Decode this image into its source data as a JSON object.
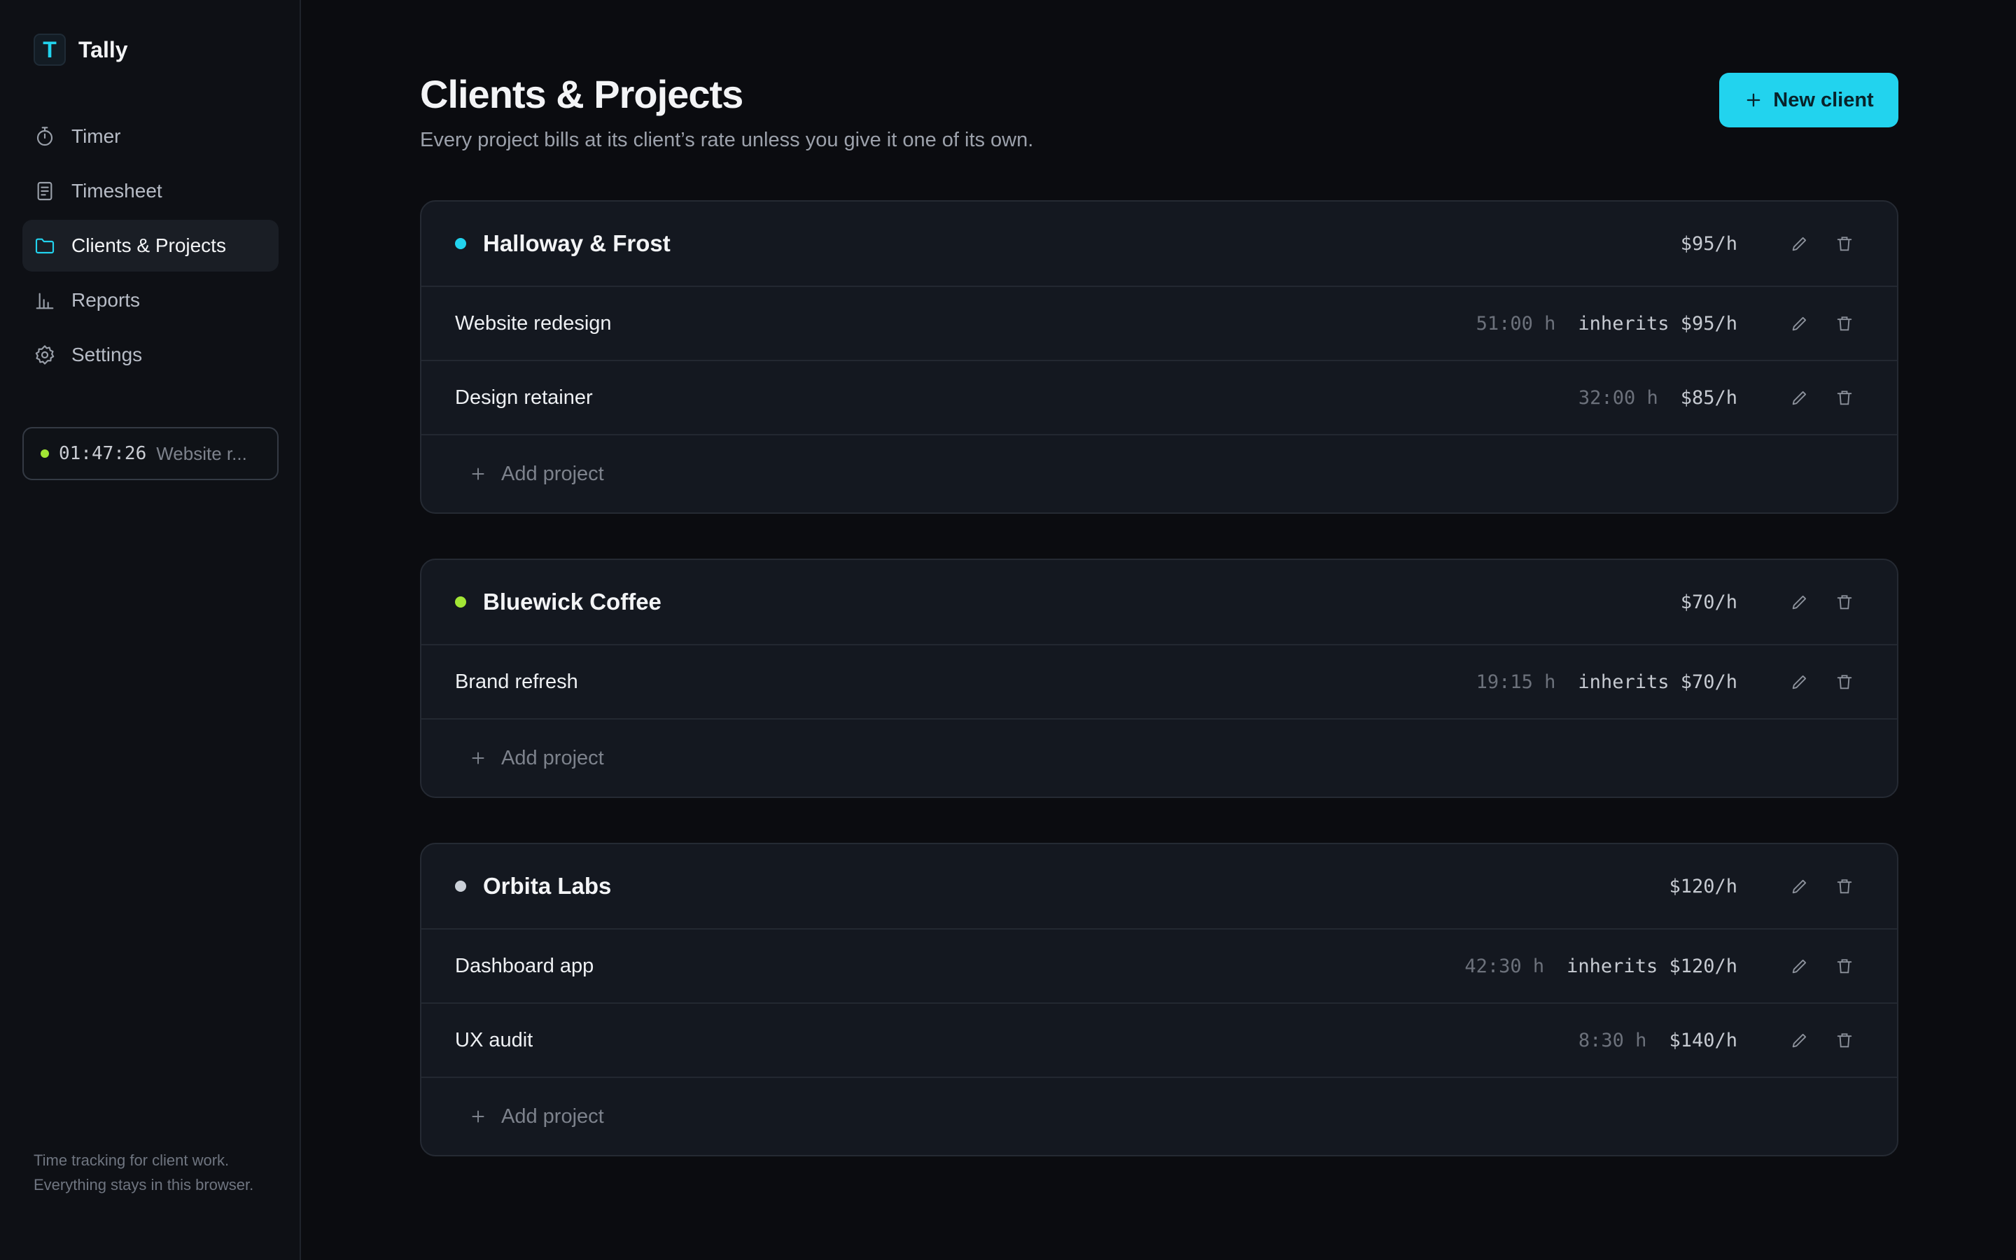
{
  "app": {
    "name": "Tally",
    "logo_letter": "T"
  },
  "sidebar": {
    "items": [
      {
        "label": "Timer",
        "icon": "stopwatch-icon"
      },
      {
        "label": "Timesheet",
        "icon": "document-icon"
      },
      {
        "label": "Clients & Projects",
        "icon": "folder-icon",
        "active": true
      },
      {
        "label": "Reports",
        "icon": "bar-chart-icon"
      },
      {
        "label": "Settings",
        "icon": "gear-icon"
      }
    ],
    "running_timer": {
      "time": "01:47:26",
      "project": "Website r..."
    },
    "footer": "Time tracking for client work. Everything stays in this browser."
  },
  "page": {
    "title": "Clients & Projects",
    "subtitle": "Every project bills at its client’s rate unless you give it one of its own.",
    "new_client_label": "New client"
  },
  "clients": [
    {
      "name": "Halloway & Frost",
      "color": "#22d3ee",
      "rate": "$95/h",
      "projects": [
        {
          "name": "Website redesign",
          "hours": "51:00 h",
          "rate": "inherits $95/h"
        },
        {
          "name": "Design retainer",
          "hours": "32:00 h",
          "rate": "$85/h"
        }
      ],
      "add_label": "Add project"
    },
    {
      "name": "Bluewick Coffee",
      "color": "#a3e635",
      "rate": "$70/h",
      "projects": [
        {
          "name": "Brand refresh",
          "hours": "19:15 h",
          "rate": "inherits $70/h"
        }
      ],
      "add_label": "Add project"
    },
    {
      "name": "Orbita Labs",
      "color": "#cbd0d8",
      "rate": "$120/h",
      "projects": [
        {
          "name": "Dashboard app",
          "hours": "42:30 h",
          "rate": "inherits $120/h"
        },
        {
          "name": "UX audit",
          "hours": "8:30 h",
          "rate": "$140/h"
        }
      ],
      "add_label": "Add project"
    }
  ],
  "colors": {
    "accent": "#22d3ee",
    "running": "#a3e635",
    "background": "#0b0c10"
  }
}
